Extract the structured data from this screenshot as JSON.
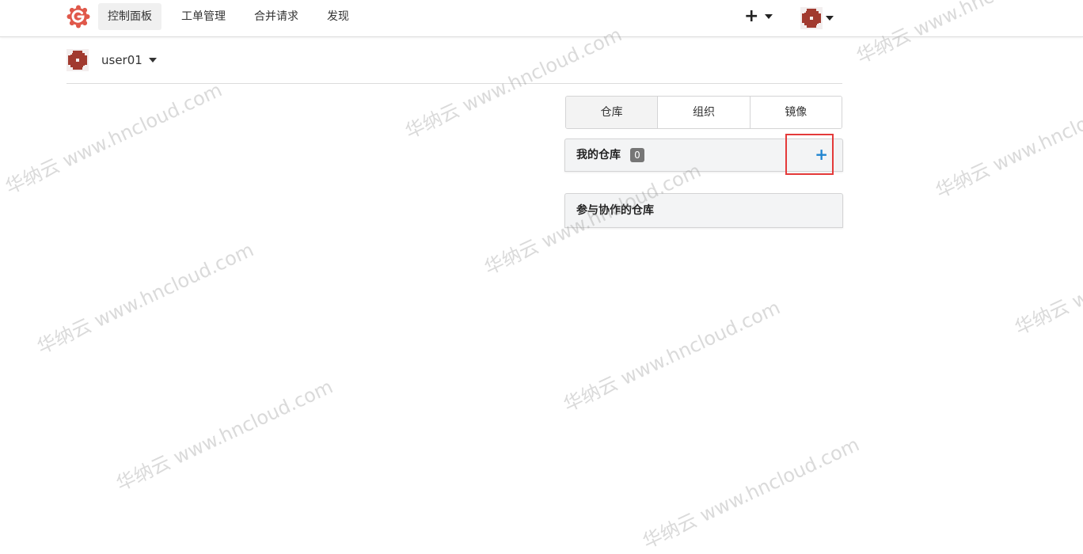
{
  "nav": {
    "items": [
      {
        "label": "控制面板",
        "active": true
      },
      {
        "label": "工单管理"
      },
      {
        "label": "合并请求"
      },
      {
        "label": "发现"
      }
    ],
    "create_icon": "+"
  },
  "context": {
    "username": "user01"
  },
  "tabs": [
    {
      "label": "仓库",
      "selected": true
    },
    {
      "label": "组织"
    },
    {
      "label": "镜像"
    }
  ],
  "repos": {
    "mine_title": "我的仓库",
    "mine_count": "0",
    "add_icon": "+",
    "collab_title": "参与协作的仓库"
  },
  "watermark": "华纳云 www.hncloud.com",
  "colors": {
    "accent": "#2185d0",
    "highlight": "#e43a3a",
    "brand": "#e0584a"
  }
}
